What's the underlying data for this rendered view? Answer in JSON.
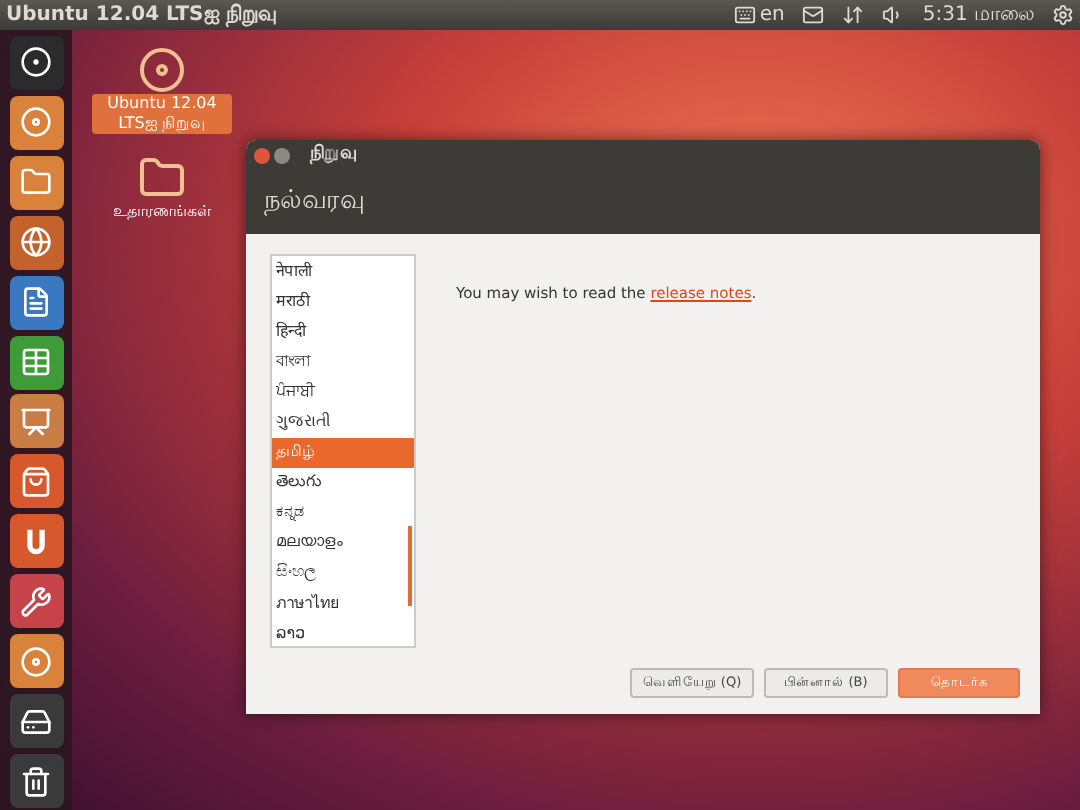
{
  "top_panel": {
    "title": "Ubuntu 12.04 LTSஐ நிறுவு",
    "keyboard_layout": "en",
    "clock": "5:31 மாலை"
  },
  "launcher": [
    {
      "kind": "dash",
      "color": "#2b2b2b"
    },
    {
      "kind": "installer",
      "color": "#d9823b"
    },
    {
      "kind": "folder",
      "color": "#d9823b"
    },
    {
      "kind": "browser",
      "color": "#c4622e"
    },
    {
      "kind": "writer",
      "color": "#3a78c2"
    },
    {
      "kind": "calc",
      "color": "#3f9a3a"
    },
    {
      "kind": "impress",
      "color": "#c97d45"
    },
    {
      "kind": "store",
      "color": "#d8582e"
    },
    {
      "kind": "ubuntu-one",
      "color": "#d8582e"
    },
    {
      "kind": "settings",
      "color": "#c7434a"
    },
    {
      "kind": "installer",
      "color": "#d9823b"
    },
    {
      "kind": "drive",
      "color": "#3a3a3a"
    },
    {
      "kind": "trash",
      "color": "#3a3a3a"
    }
  ],
  "desktop_icons": [
    {
      "kind": "installer",
      "label": "Ubuntu 12.04 LTSஐ நிறுவு",
      "selected": true
    },
    {
      "kind": "folder",
      "label": "உதாரணங்கள்",
      "selected": false
    }
  ],
  "window": {
    "title": "நிறுவு",
    "heading": "நல்வரவு",
    "languages": [
      {
        "name": "नेपाली",
        "selected": false
      },
      {
        "name": "मराठी",
        "selected": false
      },
      {
        "name": "हिन्दी",
        "selected": false
      },
      {
        "name": "বাংলা",
        "selected": false
      },
      {
        "name": "ਪੰਜਾਬੀ",
        "selected": false
      },
      {
        "name": "ગુજરાતી",
        "selected": false
      },
      {
        "name": "தமிழ்",
        "selected": true
      },
      {
        "name": "తెలుగు",
        "selected": false
      },
      {
        "name": "ಕನ್ನಡ",
        "selected": false
      },
      {
        "name": "മലയാളം",
        "selected": false
      },
      {
        "name": "සිංහල",
        "selected": false
      },
      {
        "name": "ภาษาไทย",
        "selected": false
      },
      {
        "name": "ລາວ",
        "selected": false
      }
    ],
    "message": "You may wish to read the ",
    "link": "release notes",
    "message_end": ".",
    "buttons": [
      {
        "label": "வெளியேறு (Q)",
        "kind": "normal"
      },
      {
        "label": "பின்னால் (B)",
        "kind": "normal"
      },
      {
        "label": "தொடர்க",
        "kind": "primary"
      }
    ]
  }
}
